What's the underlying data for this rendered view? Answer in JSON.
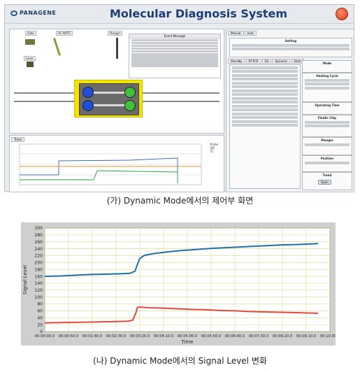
{
  "top": {
    "logo_text": "PANAGENE",
    "app_title": "Molecular Diagnosis System",
    "left_labels": [
      "Slide",
      "AC-WPTC",
      "Plunger",
      "Event Message",
      "Laser"
    ],
    "event_title": "Event Message",
    "tabs": [
      "Manual",
      "Auto"
    ],
    "sub_tabs": [
      "Standby",
      "RT-PCR",
      "QA",
      "Dynamic",
      "State"
    ],
    "panel_boxes": [
      "Setting",
      "Mode",
      "Heating Cycle",
      "Operating Time",
      "Fluidic Chip",
      "Plunger",
      "Position",
      "Trend"
    ],
    "open_button": "Open",
    "trend_tab": "Trend",
    "trend_legend": [
      "Probe",
      "QD",
      "TC"
    ]
  },
  "captions": {
    "top": "(가) Dynamic Mode에서의 제어부 화면",
    "bottom": "(나) Dynamic Mode에서의 Signal Level 변화"
  },
  "chart_data": {
    "type": "line",
    "title": "",
    "xlabel": "Time",
    "ylabel": "Signal Level",
    "ylim": [
      0,
      300
    ],
    "y_ticks": [
      0,
      20,
      40,
      60,
      80,
      100,
      120,
      140,
      160,
      180,
      200,
      220,
      240,
      260,
      280,
      300
    ],
    "x_tick_labels": [
      "00:00:00.0",
      "00:00:50.0",
      "00:01:40.0",
      "00:02:30.0",
      "00:03:20.0",
      "00:04:10.0",
      "00:05:00.0",
      "00:05:50.0",
      "00:06:40.0",
      "00:07:30.0",
      "00:08:20.0",
      "00:09:10.0",
      "00:10:00.0"
    ],
    "x_seconds": [
      0,
      50,
      100,
      150,
      200,
      250,
      300,
      350,
      400,
      450,
      500,
      550,
      600
    ],
    "grid": true,
    "series": [
      {
        "color": "#1f6fa8",
        "points": [
          [
            0,
            160
          ],
          [
            30,
            161
          ],
          [
            60,
            163
          ],
          [
            90,
            165
          ],
          [
            120,
            166
          ],
          [
            150,
            167
          ],
          [
            170,
            168
          ],
          [
            180,
            169
          ],
          [
            190,
            175
          ],
          [
            195,
            195
          ],
          [
            200,
            212
          ],
          [
            210,
            221
          ],
          [
            230,
            226
          ],
          [
            260,
            231
          ],
          [
            290,
            235
          ],
          [
            320,
            238
          ],
          [
            350,
            241
          ],
          [
            380,
            243
          ],
          [
            410,
            245
          ],
          [
            440,
            247
          ],
          [
            470,
            249
          ],
          [
            500,
            251
          ],
          [
            530,
            252
          ],
          [
            560,
            254
          ],
          [
            575,
            255
          ]
        ]
      },
      {
        "color": "#e24a3c",
        "points": [
          [
            0,
            25
          ],
          [
            40,
            26
          ],
          [
            80,
            27
          ],
          [
            120,
            28
          ],
          [
            150,
            29
          ],
          [
            175,
            30
          ],
          [
            185,
            33
          ],
          [
            192,
            55
          ],
          [
            195,
            70
          ],
          [
            200,
            71
          ],
          [
            220,
            69
          ],
          [
            250,
            68
          ],
          [
            280,
            66
          ],
          [
            310,
            64
          ],
          [
            340,
            63
          ],
          [
            370,
            61
          ],
          [
            400,
            60
          ],
          [
            430,
            58
          ],
          [
            460,
            57
          ],
          [
            490,
            56
          ],
          [
            520,
            55
          ],
          [
            550,
            54
          ],
          [
            575,
            53
          ]
        ]
      }
    ]
  }
}
